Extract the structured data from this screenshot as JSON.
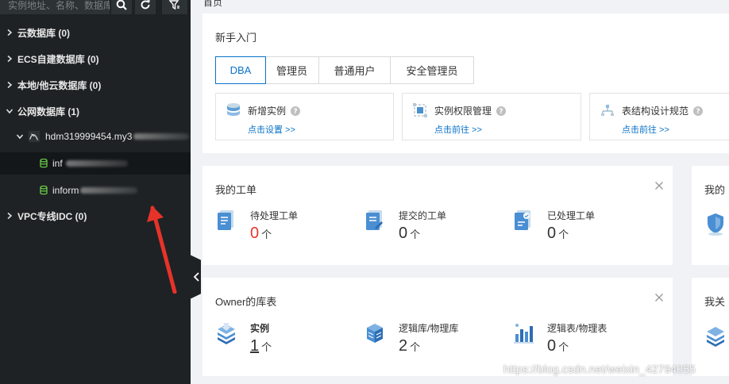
{
  "sidebar": {
    "search_placeholder": "实例地址、名称、数据库",
    "tree": [
      {
        "label": "云数据库 (0)"
      },
      {
        "label": "ECS自建数据库 (0)"
      },
      {
        "label": "本地/他云数据库 (0)"
      },
      {
        "label": "公网数据库 (1)"
      },
      {
        "label": "hdm319999454.my3"
      },
      {
        "label": "inf"
      },
      {
        "label": "inform"
      },
      {
        "label": "VPC专线IDC (0)"
      }
    ]
  },
  "main": {
    "page_title": "首页",
    "getting_started": {
      "title": "新手入门",
      "tabs": [
        "DBA",
        "管理员",
        "普通用户",
        "安全管理员"
      ],
      "guides": [
        {
          "title": "新增实例",
          "link": "点击设置 >>"
        },
        {
          "title": "实例权限管理",
          "link": "点击前往 >>"
        },
        {
          "title": "表结构设计规范",
          "link": "点击前往 >>"
        }
      ]
    },
    "my_tickets": {
      "title": "我的工单",
      "stats": [
        {
          "label": "待处理工单",
          "value": "0",
          "unit": "个"
        },
        {
          "label": "提交的工单",
          "value": "0",
          "unit": "个"
        },
        {
          "label": "已处理工单",
          "value": "0",
          "unit": "个"
        }
      ]
    },
    "side_card_1_title": "我的",
    "owner_tables": {
      "title": "Owner的库表",
      "stats": [
        {
          "label": "实例",
          "value": "1",
          "unit": "个"
        },
        {
          "label": "逻辑库/物理库",
          "value": "2",
          "unit": "个"
        },
        {
          "label": "逻辑表/物理表",
          "value": "0",
          "unit": "个"
        }
      ]
    },
    "side_card_2_title": "我关"
  },
  "watermark": "https://blog.csdn.net/weixin_42794055",
  "colors": {
    "sidebar_bg": "#1e2224",
    "accent": "#0a72c9",
    "alert_red": "#e8372b",
    "annotation_arrow": "#e6332a"
  }
}
